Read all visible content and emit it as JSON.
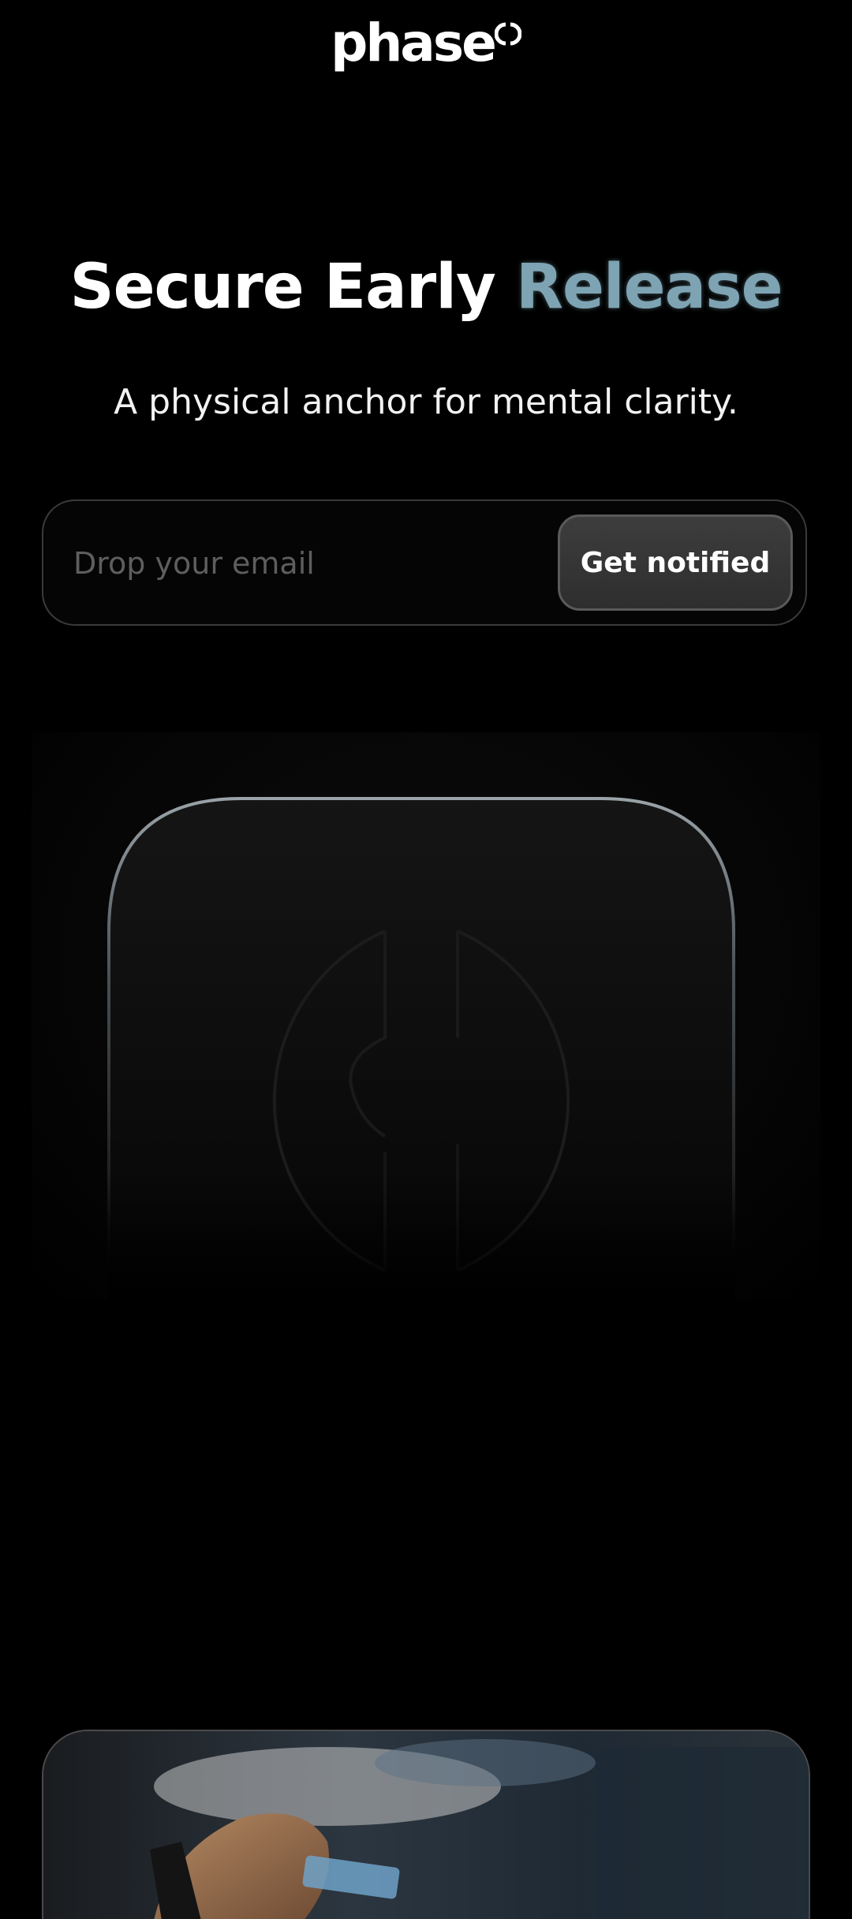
{
  "brand": {
    "name": "phase"
  },
  "hero": {
    "title_main": "Secure Early",
    "title_accent": "Release",
    "subtitle": "A physical anchor for mental clarity."
  },
  "signup": {
    "email_placeholder": "Drop your email",
    "email_value": "",
    "button_label": "Get notified"
  },
  "colors": {
    "background": "#000000",
    "accent": "#7ea4b3",
    "button_bg": "#363636",
    "input_border": "#3a3a3a"
  },
  "media": {
    "product_image": "phase-device-render",
    "lifestyle_image": "hand-using-phone-photo"
  }
}
